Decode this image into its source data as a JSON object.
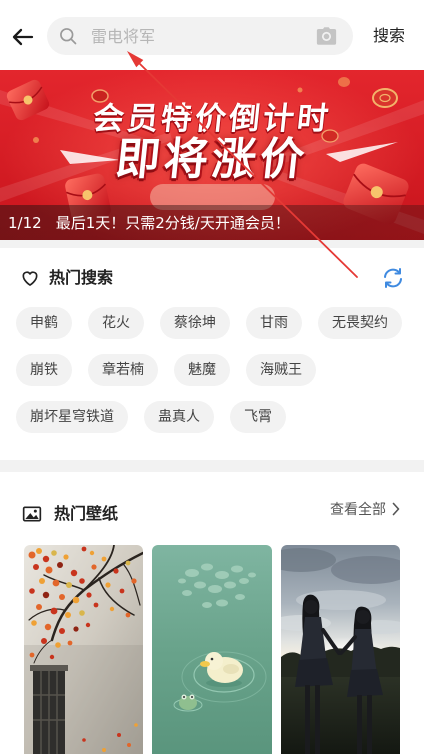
{
  "header": {
    "back_icon": "arrow-left-icon",
    "search_icon": "search-icon",
    "search_placeholder": "雷电将军",
    "camera_icon": "camera-icon",
    "search_button_label": "搜索"
  },
  "banner": {
    "headline": "会员特价倒计时",
    "subheadline": "即将涨价",
    "page_indicator": "1/12",
    "caption": "最后1天！只需2分钱/天开通会员！"
  },
  "hot_search": {
    "icon": "heart-icon",
    "title": "热门搜索",
    "refresh_icon": "refresh-icon",
    "tags": [
      "申鹤",
      "花火",
      "蔡徐坤",
      "甘雨",
      "无畏契约",
      "崩铁",
      "章若楠",
      "魅魔",
      "海贼王",
      "崩坏星穹铁道",
      "蛊真人",
      "飞霄"
    ]
  },
  "hot_wallpapers": {
    "icon": "image-icon",
    "title": "热门壁纸",
    "view_all_label": "查看全部",
    "view_all_icon": "chevron-right-icon"
  },
  "colors": {
    "accent": "#3f8ae0",
    "banner_red": "#e1232a",
    "annotation_red": "#e53935",
    "chip_background": "#f2f2f2",
    "text_primary": "#222222",
    "placeholder": "#b6b6b6"
  }
}
